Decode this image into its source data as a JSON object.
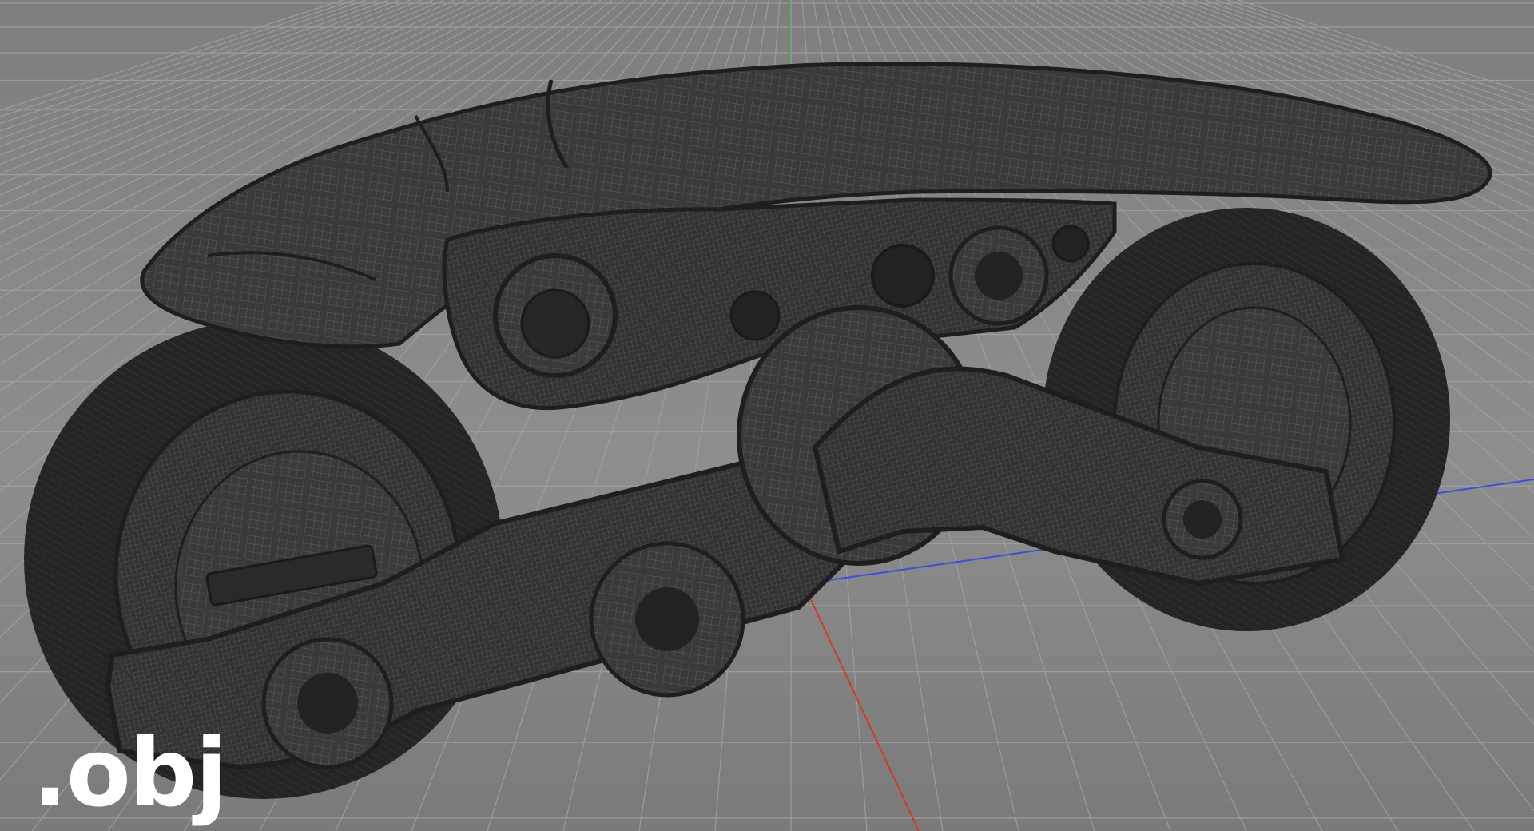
{
  "scene": {
    "description_visible": false,
    "background_color": "#8c8c8c",
    "grid_color": "#a4a4a4",
    "mesh_color": "#2d2d2d",
    "wire_color": "#505050",
    "axis_x_color": "#d03a2a",
    "axis_y_color": "#2fae3a",
    "axis_z_color": "#3a4ed8"
  },
  "overlay": {
    "format_label": ".obj"
  }
}
